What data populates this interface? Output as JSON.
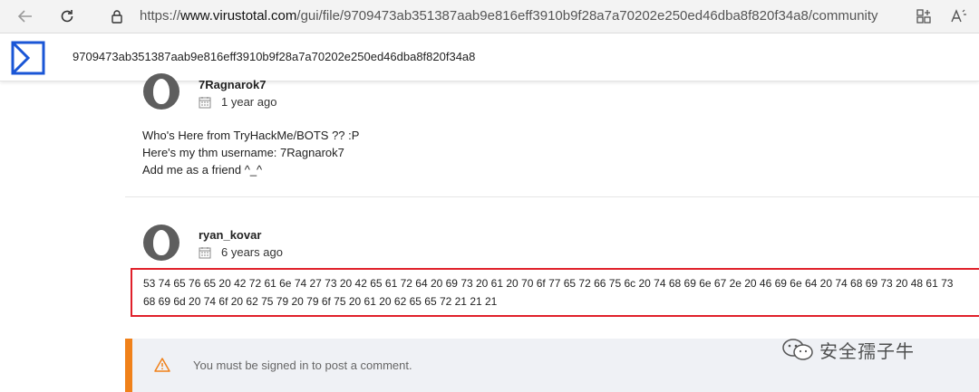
{
  "browser": {
    "url_prefix": "https://",
    "url_domain": "www.virustotal.com",
    "url_path": "/gui/file/9709473ab351387aab9e816eff3910b9f28a7a70202e250ed46dba8f820f34a8/community",
    "icons": [
      "back-arrow-icon",
      "refresh-icon",
      "lock-icon",
      "apps-icon",
      "read-aloud-icon"
    ]
  },
  "header": {
    "file_hash": "9709473ab351387aab9e816eff3910b9f28a7a70202e250ed46dba8f820f34a8"
  },
  "comments": [
    {
      "username": "7Ragnarok7",
      "date": "1 year ago",
      "lines": [
        "Who's Here from TryHackMe/BOTS ?? :P",
        "Here's my thm username: 7Ragnarok7",
        "Add me as a friend ^_^"
      ]
    },
    {
      "username": "ryan_kovar",
      "date": "6 years ago",
      "lines": [
        "53 74 65 76 65 20 42 72 61 6e 74 27 73 20 42 65 61 72 64 20 69 73 20 61 20 70 6f 77 65 72 66 75 6c 20 74 68 69 6e 67 2e 20 46 69 6e 64 20 74 68 69 73 20 48 61 73",
        "68 69 6d 20 74 6f 20 62 75 79 20 79 6f 75 20 61 20 62 65 65 72 21 21 21"
      ]
    }
  ],
  "signin": {
    "message": "You must be signed in to post a comment."
  },
  "watermark": {
    "text": "安全孺子牛"
  },
  "colors": {
    "accent_blue": "#1a56d6",
    "highlight_red": "#e0202a",
    "warning_orange": "#f0811a"
  }
}
